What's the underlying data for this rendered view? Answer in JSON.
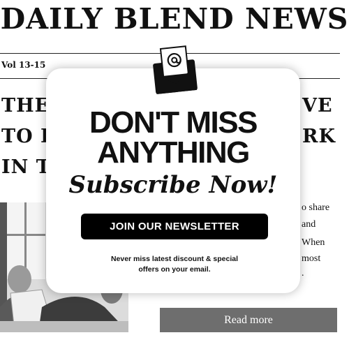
{
  "newspaper": {
    "masthead": "DAILY BLEND NEWS",
    "volume": "Vol 13-15",
    "headline_left": [
      "THE",
      "TO L",
      "IN TH"
    ],
    "headline_right": [
      "VE",
      "RK"
    ],
    "body_fragments": [
      "o share",
      "and",
      "When",
      "most",
      "."
    ],
    "read_more_label": "Read more"
  },
  "popup": {
    "title_line1": "DON'T MISS",
    "title_line2": "ANYTHING",
    "subtitle": "Subscribe Now!",
    "button_label": "JOIN OUR NEWSLETTER",
    "note_line1": "Never miss latest discount & special",
    "note_line2": "offers on your email."
  },
  "icons": {
    "envelope": "envelope-at-icon"
  }
}
